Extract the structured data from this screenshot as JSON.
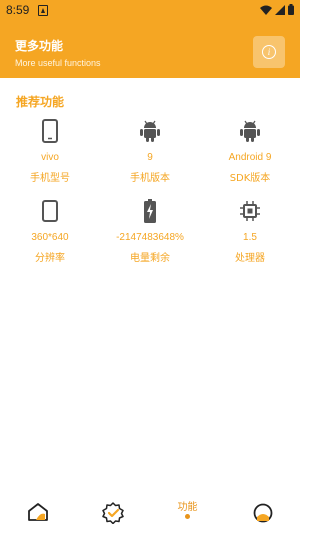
{
  "status_bar": {
    "time": "8:59"
  },
  "header": {
    "title": "更多功能",
    "subtitle": "More useful functions"
  },
  "section": {
    "title": "推荐功能"
  },
  "features": [
    {
      "icon": "phone-icon",
      "value": "vivo",
      "label": "手机型号"
    },
    {
      "icon": "android-icon",
      "value": "9",
      "label": "手机版本"
    },
    {
      "icon": "android-icon",
      "value": "Android 9",
      "label": "SDK版本"
    },
    {
      "icon": "screen-icon",
      "value": "360*640",
      "label": "分辨率"
    },
    {
      "icon": "battery-icon",
      "value": "-2147483648%",
      "label": "电量剩余"
    },
    {
      "icon": "cpu-icon",
      "value": "1.5",
      "label": "处理器"
    }
  ],
  "bottom_nav": {
    "items": [
      {
        "icon": "home-icon"
      },
      {
        "icon": "badge-check-icon"
      },
      {
        "label": "功能",
        "active": true
      },
      {
        "icon": "profile-icon"
      }
    ]
  },
  "colors": {
    "accent": "#f5a623",
    "icon": "#555555"
  }
}
